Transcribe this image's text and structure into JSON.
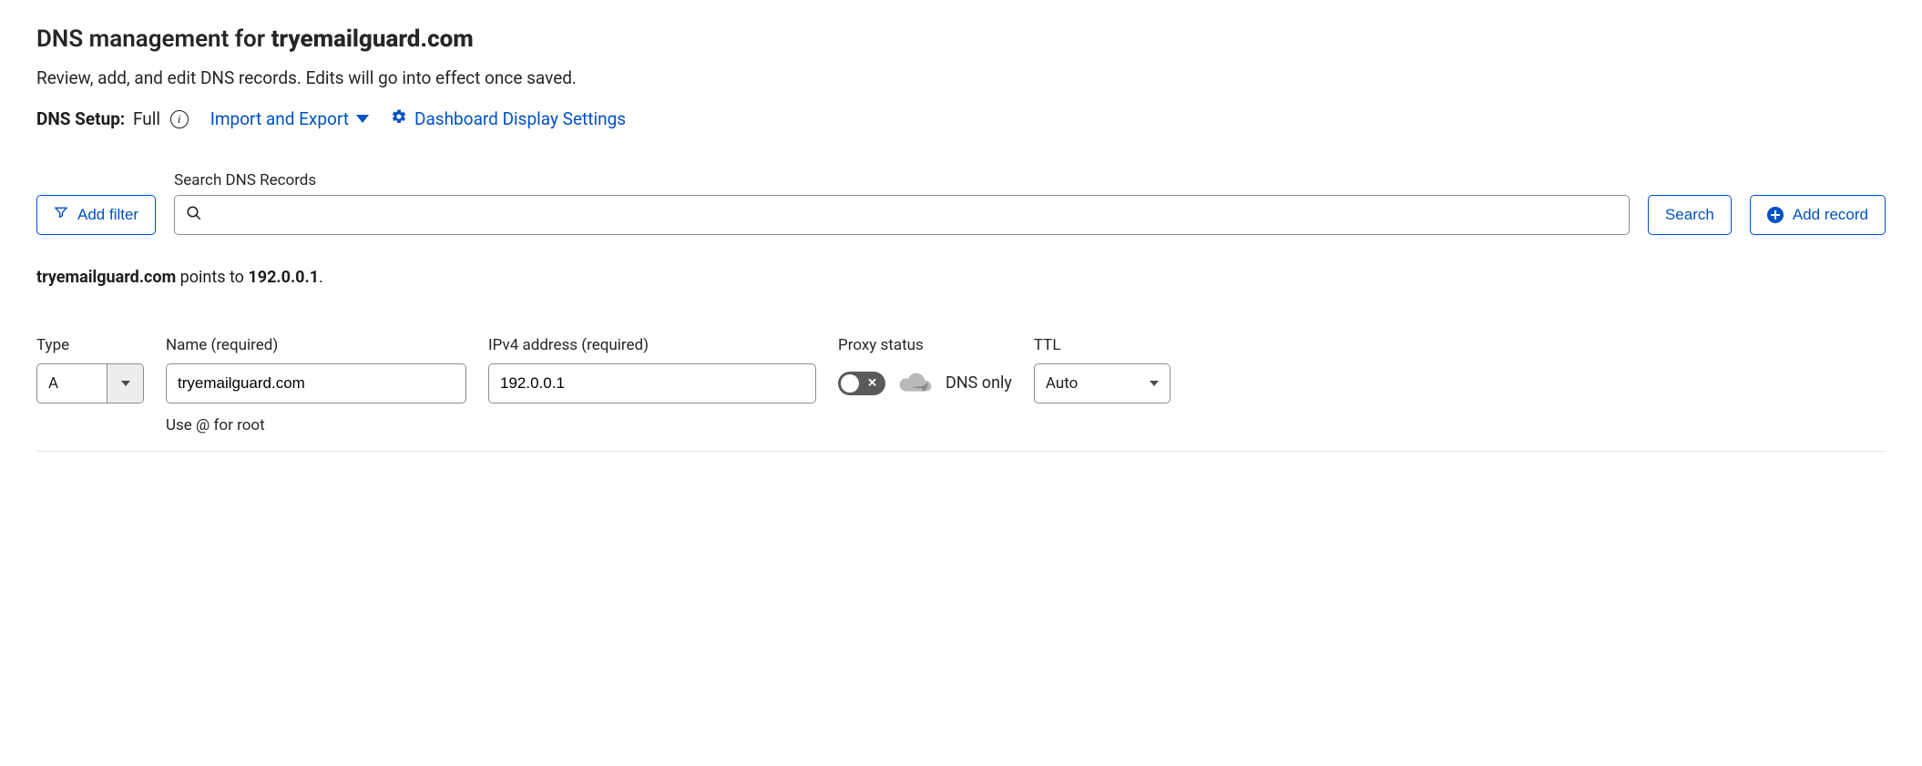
{
  "header": {
    "title_prefix": "DNS management for ",
    "domain": "tryemailguard.com",
    "subtitle": "Review, add, and edit DNS records. Edits will go into effect once saved.",
    "setup_label": "DNS Setup:",
    "setup_value": "Full",
    "import_export": "Import and Export",
    "display_settings": "Dashboard Display Settings"
  },
  "toolbar": {
    "add_filter": "Add filter",
    "search_label": "Search DNS Records",
    "search_value": "",
    "search_btn": "Search",
    "add_record": "Add record"
  },
  "points_to": {
    "domain": "tryemailguard.com",
    "middle": " points to ",
    "ip": "192.0.0.1",
    "suffix": "."
  },
  "record": {
    "type": {
      "label": "Type",
      "value": "A"
    },
    "name": {
      "label": "Name (required)",
      "value": "tryemailguard.com",
      "hint": "Use @ for root"
    },
    "ip": {
      "label": "IPv4 address (required)",
      "value": "192.0.0.1"
    },
    "proxy": {
      "label": "Proxy status",
      "text": "DNS only",
      "on": false
    },
    "ttl": {
      "label": "TTL",
      "value": "Auto"
    }
  }
}
